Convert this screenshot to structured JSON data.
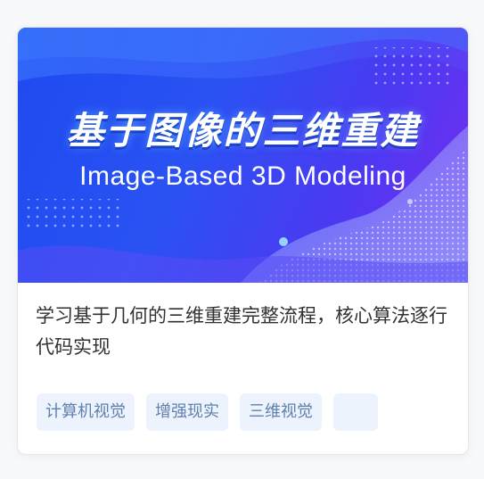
{
  "banner": {
    "title": "基于图像的三维重建",
    "subtitle": "Image-Based 3D Modeling"
  },
  "course": {
    "description": "学习基于几何的三维重建完整流程，核心算法逐行代码实现"
  },
  "tags": [
    "计算机视觉",
    "增强现实",
    "三维视觉",
    ""
  ],
  "colors": {
    "banner_gradient_start": "#1d4af0",
    "banner_gradient_end": "#7a2cf0",
    "tag_background": "#edf3fc",
    "tag_text": "#5f7fad"
  }
}
